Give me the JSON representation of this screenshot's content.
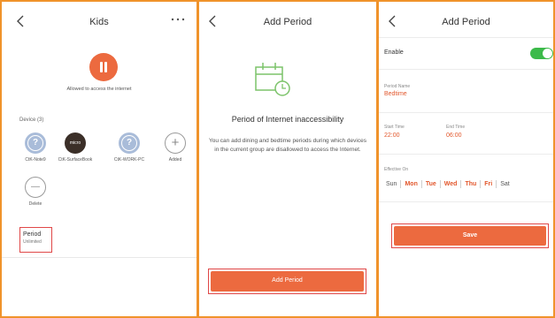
{
  "icons": {
    "back": "chevron-left-icon",
    "more": "more-dots-icon",
    "pause": "pause-icon",
    "calendar": "calendar-clock-icon"
  },
  "colors": {
    "accent": "#ec6a3f",
    "highlight_border": "#e04848",
    "toggle_on": "#3cba4a",
    "value_text": "#e2572c",
    "panel_border": "#f0932b"
  },
  "panel1": {
    "title": "Kids",
    "status_text": "Allowed to access the internet",
    "device_section_label": "Device  (3)",
    "devices": [
      {
        "label": "CtK-Note9",
        "avatar": "?"
      },
      {
        "label": "CtK-SurfaceBook",
        "avatar": "micro"
      },
      {
        "label": "CtK-WORK-PC",
        "avatar": "?"
      },
      {
        "label": "Added",
        "avatar": "+"
      }
    ],
    "delete": {
      "label": "Delete",
      "symbol": "—"
    },
    "period": {
      "title": "Period",
      "value": "Unlimited"
    }
  },
  "panel2": {
    "title": "Add Period",
    "heading": "Period of Internet inaccessibility",
    "description": "You can add dining and bedtime periods during which devices in the current group are disallowed to access the Internet.",
    "button_label": "Add Period"
  },
  "panel3": {
    "title": "Add Period",
    "enable_label": "Enable",
    "enabled": true,
    "period_name_label": "Period Name",
    "period_name_value": "Bedtime",
    "start_time_label": "Start Time",
    "start_time_value": "22:00",
    "end_time_label": "End Time",
    "end_time_value": "06:00",
    "effective_label": "Effective On",
    "days": [
      {
        "label": "Sun",
        "selected": false
      },
      {
        "label": "Mon",
        "selected": true
      },
      {
        "label": "Tue",
        "selected": true
      },
      {
        "label": "Wed",
        "selected": true
      },
      {
        "label": "Thu",
        "selected": true
      },
      {
        "label": "Fri",
        "selected": true
      },
      {
        "label": "Sat",
        "selected": false
      }
    ],
    "save_label": "Save"
  }
}
